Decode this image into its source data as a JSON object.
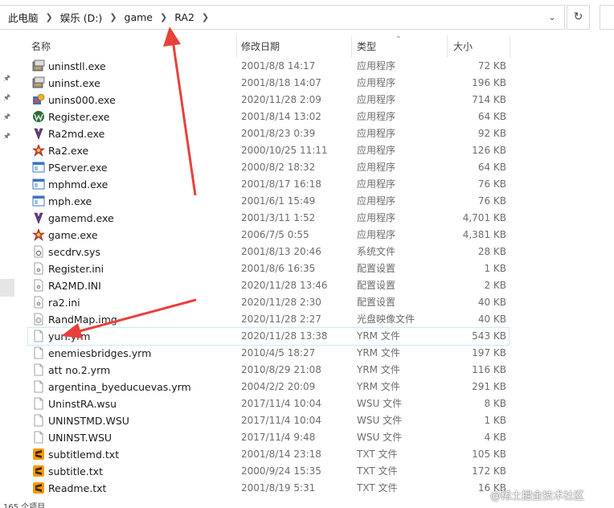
{
  "breadcrumb": [
    "此电脑",
    "娱乐 (D:)",
    "game",
    "RA2"
  ],
  "columns": {
    "name": "名称",
    "date": "修改日期",
    "type": "类型",
    "size": "大小"
  },
  "files": [
    {
      "name": "uninstll.exe",
      "date": "2001/8/8 14:17",
      "type": "应用程序",
      "size": "72 KB",
      "icon": "installer-icon"
    },
    {
      "name": "uninst.exe",
      "date": "2001/8/18 14:07",
      "type": "应用程序",
      "size": "196 KB",
      "icon": "installer-icon"
    },
    {
      "name": "unins000.exe",
      "date": "2020/11/28 2:09",
      "type": "应用程序",
      "size": "714 KB",
      "icon": "setup-icon"
    },
    {
      "name": "Register.exe",
      "date": "2001/8/14 13:02",
      "type": "应用程序",
      "size": "64 KB",
      "icon": "w-logo-icon"
    },
    {
      "name": "Ra2md.exe",
      "date": "2001/8/23 0:39",
      "type": "应用程序",
      "size": "92 KB",
      "icon": "yuri-icon"
    },
    {
      "name": "Ra2.exe",
      "date": "2000/10/25 11:11",
      "type": "应用程序",
      "size": "126 KB",
      "icon": "ra2-icon"
    },
    {
      "name": "PServer.exe",
      "date": "2000/8/2 18:32",
      "type": "应用程序",
      "size": "64 KB",
      "icon": "window-app-icon"
    },
    {
      "name": "mphmd.exe",
      "date": "2001/8/17 16:18",
      "type": "应用程序",
      "size": "76 KB",
      "icon": "window-app-icon"
    },
    {
      "name": "mph.exe",
      "date": "2001/6/1 15:49",
      "type": "应用程序",
      "size": "76 KB",
      "icon": "window-app-icon"
    },
    {
      "name": "gamemd.exe",
      "date": "2001/3/11 1:52",
      "type": "应用程序",
      "size": "4,701 KB",
      "icon": "yuri-icon"
    },
    {
      "name": "game.exe",
      "date": "2006/7/5 0:55",
      "type": "应用程序",
      "size": "4,381 KB",
      "icon": "ra2-icon"
    },
    {
      "name": "secdrv.sys",
      "date": "2001/8/13 20:46",
      "type": "系统文件",
      "size": "28 KB",
      "icon": "system-file-icon"
    },
    {
      "name": "Register.ini",
      "date": "2001/8/6 16:35",
      "type": "配置设置",
      "size": "1 KB",
      "icon": "settings-file-icon"
    },
    {
      "name": "RA2MD.INI",
      "date": "2020/11/28 13:46",
      "type": "配置设置",
      "size": "2 KB",
      "icon": "settings-file-icon"
    },
    {
      "name": "ra2.ini",
      "date": "2020/11/28 2:30",
      "type": "配置设置",
      "size": "40 KB",
      "icon": "settings-file-icon"
    },
    {
      "name": "RandMap.img",
      "date": "2020/11/28 2:27",
      "type": "光盘映像文件",
      "size": "40 KB",
      "icon": "disc-image-icon"
    },
    {
      "name": "yuri.yrm",
      "date": "2020/11/28 13:38",
      "type": "YRM 文件",
      "size": "543 KB",
      "icon": "blank-file-icon"
    },
    {
      "name": "enemiesbridges.yrm",
      "date": "2010/4/5 18:27",
      "type": "YRM 文件",
      "size": "197 KB",
      "icon": "blank-file-icon"
    },
    {
      "name": "att no.2.yrm",
      "date": "2010/8/29 21:08",
      "type": "YRM 文件",
      "size": "116 KB",
      "icon": "blank-file-icon"
    },
    {
      "name": "argentina_byeducuevas.yrm",
      "date": "2004/2/2 20:09",
      "type": "YRM 文件",
      "size": "291 KB",
      "icon": "blank-file-icon"
    },
    {
      "name": "UninstRA.wsu",
      "date": "2017/11/4 10:04",
      "type": "WSU 文件",
      "size": "8 KB",
      "icon": "blank-file-icon"
    },
    {
      "name": "UNINSTMD.WSU",
      "date": "2017/11/4 10:04",
      "type": "WSU 文件",
      "size": "1 KB",
      "icon": "blank-file-icon"
    },
    {
      "name": "UNINST.WSU",
      "date": "2017/11/4 9:48",
      "type": "WSU 文件",
      "size": "4 KB",
      "icon": "blank-file-icon"
    },
    {
      "name": "subtitlemd.txt",
      "date": "2001/8/14 23:18",
      "type": "TXT 文件",
      "size": "105 KB",
      "icon": "sublime-icon"
    },
    {
      "name": "subtitle.txt",
      "date": "2000/9/24 15:35",
      "type": "TXT 文件",
      "size": "172 KB",
      "icon": "sublime-icon"
    },
    {
      "name": "Readme.txt",
      "date": "2001/8/19 5:31",
      "type": "TXT 文件",
      "size": "16 KB",
      "icon": "sublime-icon"
    }
  ],
  "status_text": "165 个项目",
  "watermark": "@稀土掘金技术社区",
  "colors": {
    "annotation_arrow": "#e8413c",
    "selection_outline": "#cce8ff"
  }
}
